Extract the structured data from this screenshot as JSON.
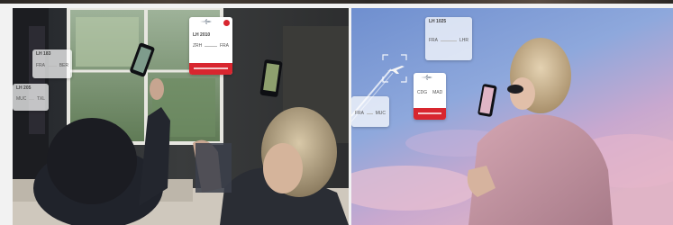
{
  "colors": {
    "page_background": "#f2f2f2",
    "card_red": "#d8262f",
    "card_white": "#ffffff",
    "sky_blue": "#7fa1d8",
    "sky_pink": "#d9a6c0",
    "hoodie_pink": "#c99aa8",
    "room_dark": "#2a2d33"
  },
  "icons": {
    "plane": "plane-icon",
    "focus_frame": "focus-bracket-icon",
    "arrow": "route-arrow-icon"
  },
  "left_photo": {
    "cards": [
      {
        "code": "LH 183",
        "from": "FRA",
        "to": "BER"
      },
      {
        "code": "LH 205",
        "from": "MUC",
        "to": "TXL"
      },
      {
        "code": "LH 2010",
        "from": "ZRH",
        "to": "FRA"
      }
    ]
  },
  "right_photo": {
    "cards": [
      {
        "code": "LH 1025",
        "from": "FRA",
        "to": "LHR"
      },
      {
        "code": "",
        "from": "FRA",
        "to": "MUC"
      },
      {
        "code": "",
        "from": "CDG",
        "to": "MAD"
      }
    ]
  }
}
